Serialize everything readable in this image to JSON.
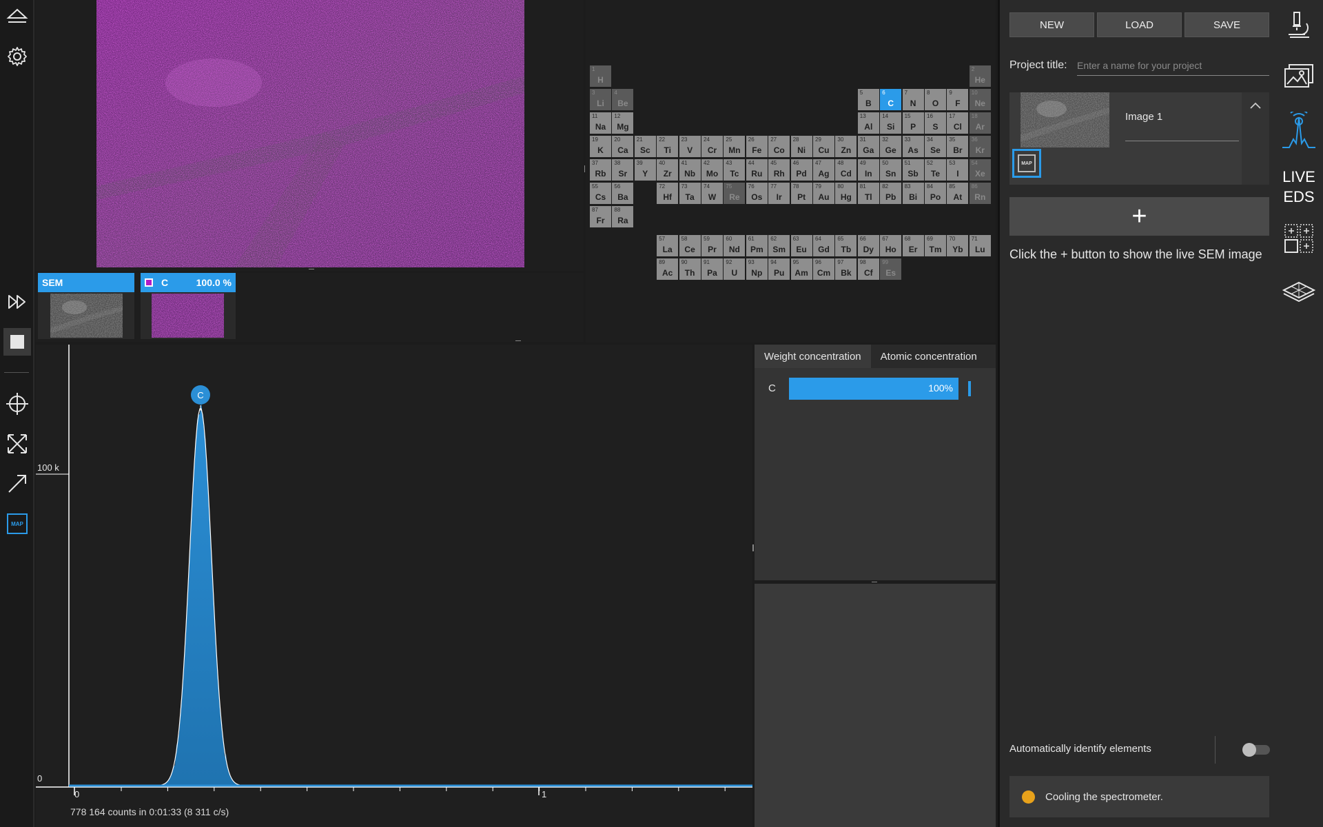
{
  "colors": {
    "accent": "#2b9be9",
    "panel": "#2a2a2a",
    "status_warning": "#e8a21b",
    "map_magenta": "#b21cc7"
  },
  "left_toolbar": {
    "icons": [
      "eject-icon",
      "gear-icon",
      "fast-forward-icon",
      "stop-icon",
      "crosshair-icon",
      "expand-icon",
      "arrow-icon",
      "map-icon"
    ],
    "map_label": "MAP"
  },
  "thumbnails": [
    {
      "label": "SEM",
      "value": ""
    },
    {
      "label": "C",
      "value": "100.0 %"
    }
  ],
  "periodic_table": {
    "selected": [
      "C"
    ],
    "elements": [
      {
        "z": "1",
        "s": "H",
        "r": 1,
        "c": 1,
        "dim": true
      },
      {
        "z": "2",
        "s": "He",
        "r": 1,
        "c": 18,
        "dim": true
      },
      {
        "z": "3",
        "s": "Li",
        "r": 2,
        "c": 1,
        "dim": true
      },
      {
        "z": "4",
        "s": "Be",
        "r": 2,
        "c": 2,
        "dim": true
      },
      {
        "z": "5",
        "s": "B",
        "r": 2,
        "c": 13
      },
      {
        "z": "6",
        "s": "C",
        "r": 2,
        "c": 14
      },
      {
        "z": "7",
        "s": "N",
        "r": 2,
        "c": 15
      },
      {
        "z": "8",
        "s": "O",
        "r": 2,
        "c": 16
      },
      {
        "z": "9",
        "s": "F",
        "r": 2,
        "c": 17
      },
      {
        "z": "10",
        "s": "Ne",
        "r": 2,
        "c": 18,
        "dim": true
      },
      {
        "z": "11",
        "s": "Na",
        "r": 3,
        "c": 1
      },
      {
        "z": "12",
        "s": "Mg",
        "r": 3,
        "c": 2
      },
      {
        "z": "13",
        "s": "Al",
        "r": 3,
        "c": 13
      },
      {
        "z": "14",
        "s": "Si",
        "r": 3,
        "c": 14
      },
      {
        "z": "15",
        "s": "P",
        "r": 3,
        "c": 15
      },
      {
        "z": "16",
        "s": "S",
        "r": 3,
        "c": 16
      },
      {
        "z": "17",
        "s": "Cl",
        "r": 3,
        "c": 17
      },
      {
        "z": "18",
        "s": "Ar",
        "r": 3,
        "c": 18,
        "dim": true
      },
      {
        "z": "19",
        "s": "K",
        "r": 4,
        "c": 1
      },
      {
        "z": "20",
        "s": "Ca",
        "r": 4,
        "c": 2
      },
      {
        "z": "21",
        "s": "Sc",
        "r": 4,
        "c": 3
      },
      {
        "z": "22",
        "s": "Ti",
        "r": 4,
        "c": 4
      },
      {
        "z": "23",
        "s": "V",
        "r": 4,
        "c": 5
      },
      {
        "z": "24",
        "s": "Cr",
        "r": 4,
        "c": 6
      },
      {
        "z": "25",
        "s": "Mn",
        "r": 4,
        "c": 7
      },
      {
        "z": "26",
        "s": "Fe",
        "r": 4,
        "c": 8
      },
      {
        "z": "27",
        "s": "Co",
        "r": 4,
        "c": 9
      },
      {
        "z": "28",
        "s": "Ni",
        "r": 4,
        "c": 10
      },
      {
        "z": "29",
        "s": "Cu",
        "r": 4,
        "c": 11
      },
      {
        "z": "30",
        "s": "Zn",
        "r": 4,
        "c": 12
      },
      {
        "z": "31",
        "s": "Ga",
        "r": 4,
        "c": 13
      },
      {
        "z": "32",
        "s": "Ge",
        "r": 4,
        "c": 14
      },
      {
        "z": "33",
        "s": "As",
        "r": 4,
        "c": 15
      },
      {
        "z": "34",
        "s": "Se",
        "r": 4,
        "c": 16
      },
      {
        "z": "35",
        "s": "Br",
        "r": 4,
        "c": 17
      },
      {
        "z": "36",
        "s": "Kr",
        "r": 4,
        "c": 18,
        "dim": true
      },
      {
        "z": "37",
        "s": "Rb",
        "r": 5,
        "c": 1
      },
      {
        "z": "38",
        "s": "Sr",
        "r": 5,
        "c": 2
      },
      {
        "z": "39",
        "s": "Y",
        "r": 5,
        "c": 3
      },
      {
        "z": "40",
        "s": "Zr",
        "r": 5,
        "c": 4
      },
      {
        "z": "41",
        "s": "Nb",
        "r": 5,
        "c": 5
      },
      {
        "z": "42",
        "s": "Mo",
        "r": 5,
        "c": 6
      },
      {
        "z": "43",
        "s": "Tc",
        "r": 5,
        "c": 7
      },
      {
        "z": "44",
        "s": "Ru",
        "r": 5,
        "c": 8
      },
      {
        "z": "45",
        "s": "Rh",
        "r": 5,
        "c": 9
      },
      {
        "z": "46",
        "s": "Pd",
        "r": 5,
        "c": 10
      },
      {
        "z": "47",
        "s": "Ag",
        "r": 5,
        "c": 11
      },
      {
        "z": "48",
        "s": "Cd",
        "r": 5,
        "c": 12
      },
      {
        "z": "49",
        "s": "In",
        "r": 5,
        "c": 13
      },
      {
        "z": "50",
        "s": "Sn",
        "r": 5,
        "c": 14
      },
      {
        "z": "51",
        "s": "Sb",
        "r": 5,
        "c": 15
      },
      {
        "z": "52",
        "s": "Te",
        "r": 5,
        "c": 16
      },
      {
        "z": "53",
        "s": "I",
        "r": 5,
        "c": 17
      },
      {
        "z": "54",
        "s": "Xe",
        "r": 5,
        "c": 18,
        "dim": true
      },
      {
        "z": "55",
        "s": "Cs",
        "r": 6,
        "c": 1
      },
      {
        "z": "56",
        "s": "Ba",
        "r": 6,
        "c": 2
      },
      {
        "z": "72",
        "s": "Hf",
        "r": 6,
        "c": 4
      },
      {
        "z": "73",
        "s": "Ta",
        "r": 6,
        "c": 5
      },
      {
        "z": "74",
        "s": "W",
        "r": 6,
        "c": 6
      },
      {
        "z": "75",
        "s": "Re",
        "r": 6,
        "c": 7,
        "dim": true
      },
      {
        "z": "76",
        "s": "Os",
        "r": 6,
        "c": 8
      },
      {
        "z": "77",
        "s": "Ir",
        "r": 6,
        "c": 9
      },
      {
        "z": "78",
        "s": "Pt",
        "r": 6,
        "c": 10
      },
      {
        "z": "79",
        "s": "Au",
        "r": 6,
        "c": 11
      },
      {
        "z": "80",
        "s": "Hg",
        "r": 6,
        "c": 12
      },
      {
        "z": "81",
        "s": "Tl",
        "r": 6,
        "c": 13
      },
      {
        "z": "82",
        "s": "Pb",
        "r": 6,
        "c": 14
      },
      {
        "z": "83",
        "s": "Bi",
        "r": 6,
        "c": 15
      },
      {
        "z": "84",
        "s": "Po",
        "r": 6,
        "c": 16
      },
      {
        "z": "85",
        "s": "At",
        "r": 6,
        "c": 17
      },
      {
        "z": "86",
        "s": "Rn",
        "r": 6,
        "c": 18,
        "dim": true
      },
      {
        "z": "87",
        "s": "Fr",
        "r": 7,
        "c": 1
      },
      {
        "z": "88",
        "s": "Ra",
        "r": 7,
        "c": 2
      },
      {
        "z": "57",
        "s": "La",
        "r": 9,
        "c": 4
      },
      {
        "z": "58",
        "s": "Ce",
        "r": 9,
        "c": 5
      },
      {
        "z": "59",
        "s": "Pr",
        "r": 9,
        "c": 6
      },
      {
        "z": "60",
        "s": "Nd",
        "r": 9,
        "c": 7
      },
      {
        "z": "61",
        "s": "Pm",
        "r": 9,
        "c": 8
      },
      {
        "z": "62",
        "s": "Sm",
        "r": 9,
        "c": 9
      },
      {
        "z": "63",
        "s": "Eu",
        "r": 9,
        "c": 10
      },
      {
        "z": "64",
        "s": "Gd",
        "r": 9,
        "c": 11
      },
      {
        "z": "65",
        "s": "Tb",
        "r": 9,
        "c": 12
      },
      {
        "z": "66",
        "s": "Dy",
        "r": 9,
        "c": 13
      },
      {
        "z": "67",
        "s": "Ho",
        "r": 9,
        "c": 14
      },
      {
        "z": "68",
        "s": "Er",
        "r": 9,
        "c": 15
      },
      {
        "z": "69",
        "s": "Tm",
        "r": 9,
        "c": 16
      },
      {
        "z": "70",
        "s": "Yb",
        "r": 9,
        "c": 17
      },
      {
        "z": "71",
        "s": "Lu",
        "r": 9,
        "c": 18
      },
      {
        "z": "89",
        "s": "Ac",
        "r": 10,
        "c": 4
      },
      {
        "z": "90",
        "s": "Th",
        "r": 10,
        "c": 5
      },
      {
        "z": "91",
        "s": "Pa",
        "r": 10,
        "c": 6
      },
      {
        "z": "92",
        "s": "U",
        "r": 10,
        "c": 7
      },
      {
        "z": "93",
        "s": "Np",
        "r": 10,
        "c": 8
      },
      {
        "z": "94",
        "s": "Pu",
        "r": 10,
        "c": 9
      },
      {
        "z": "95",
        "s": "Am",
        "r": 10,
        "c": 10
      },
      {
        "z": "96",
        "s": "Cm",
        "r": 10,
        "c": 11
      },
      {
        "z": "97",
        "s": "Bk",
        "r": 10,
        "c": 12
      },
      {
        "z": "98",
        "s": "Cf",
        "r": 10,
        "c": 13
      },
      {
        "z": "99",
        "s": "Es",
        "r": 10,
        "c": 14,
        "dim": true
      }
    ]
  },
  "spectrum": {
    "peak_label": "C",
    "y_tick_labels": [
      "100 k",
      "0"
    ],
    "x_tick_labels": [
      "0",
      "1"
    ],
    "footer": "778 164 counts in 0:01:33 (8 311 c/s)"
  },
  "concentration": {
    "tabs": [
      "Weight concentration",
      "Atomic concentration"
    ],
    "active_tab": 0,
    "rows": [
      {
        "element": "C",
        "value": "100%",
        "fraction": 1.0
      }
    ]
  },
  "right_panel": {
    "buttons": {
      "new": "NEW",
      "load": "LOAD",
      "save": "SAVE"
    },
    "project_title_label": "Project title:",
    "project_title_placeholder": "Enter a name for your project",
    "image_card": {
      "name": "Image 1",
      "map_label": "MAP"
    },
    "add_label": "+",
    "hint": "Click the + button to show the live SEM image",
    "auto_identify_label": "Automatically identify elements",
    "auto_identify_on": false,
    "status": "Cooling the spectrometer."
  },
  "right_nav": {
    "icons": [
      "microscope-icon",
      "images-icon",
      "live-eds-icon",
      "grid-select-icon",
      "layers-icon"
    ],
    "live_eds_line1": "LIVE",
    "live_eds_line2": "EDS"
  }
}
